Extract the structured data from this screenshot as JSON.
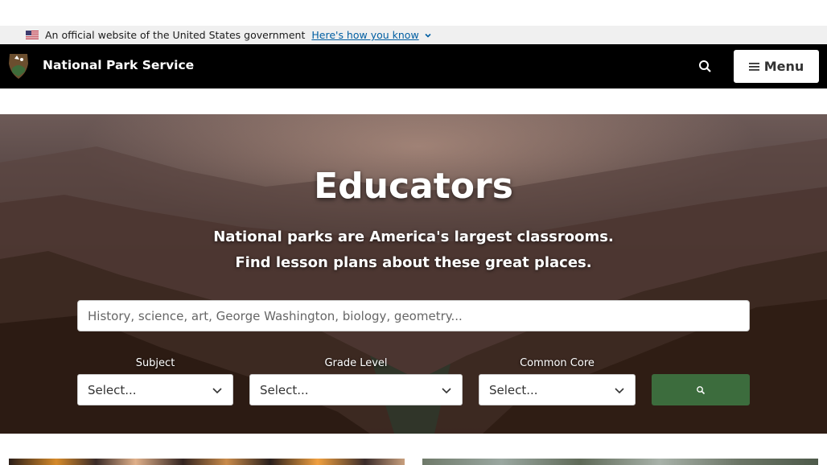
{
  "gov_banner": {
    "text": "An official website of the United States government",
    "how_link": "Here's how you know"
  },
  "header": {
    "site_title": "National Park Service",
    "menu_label": "Menu"
  },
  "hero": {
    "title": "Educators",
    "tagline_1": "National parks are America's largest classrooms.",
    "tagline_2": "Find lesson plans about these great places.",
    "search_placeholder": "History, science, art, George Washington, biology, geometry..."
  },
  "filters": [
    {
      "label": "Subject",
      "value": "Select..."
    },
    {
      "label": "Grade Level",
      "value": "Select..."
    },
    {
      "label": "Common Core",
      "value": "Select..."
    }
  ],
  "colors": {
    "header_bg": "#000000",
    "banner_bg": "#f0f0f0",
    "link": "#005ea2",
    "search_button": "#3c6c3d"
  }
}
